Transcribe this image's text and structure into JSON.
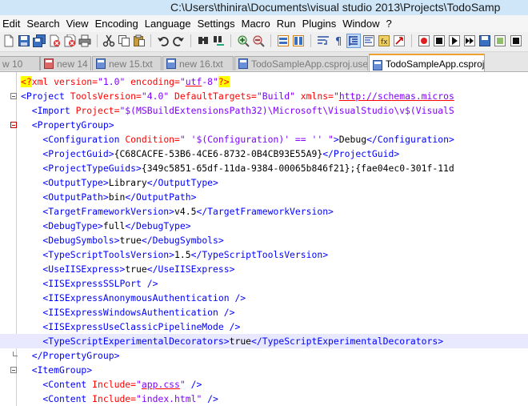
{
  "window": {
    "title": "C:\\Users\\thinira\\Documents\\visual studio 2013\\Projects\\TodoSamp"
  },
  "menubar": {
    "items": [
      "Edit",
      "Search",
      "View",
      "Encoding",
      "Language",
      "Settings",
      "Macro",
      "Run",
      "Plugins",
      "Window",
      "?"
    ]
  },
  "toolbar": {
    "icons": [
      "new-file-icon",
      "save-icon",
      "save-all-icon",
      "close-icon",
      "close-all-icon",
      "print-icon",
      "cut-icon",
      "copy-icon",
      "paste-icon",
      "undo-icon",
      "redo-icon",
      "find-icon",
      "replace-icon",
      "zoom-in-icon",
      "zoom-out-icon",
      "sync-v-icon",
      "sync-h-icon",
      "word-wrap-icon",
      "show-all-chars-icon",
      "indent-guide-icon",
      "doc-map-icon",
      "function-list-icon",
      "record-icon",
      "stop-icon",
      "play-icon",
      "play-multiple-icon",
      "save-macro-icon"
    ]
  },
  "tabs": [
    {
      "label": "w 10"
    },
    {
      "label": "new 14"
    },
    {
      "label": "new 15.txt"
    },
    {
      "label": "new 16.txt"
    },
    {
      "label": "TodoSampleApp.csproj.user"
    },
    {
      "label": "TodoSampleApp.csproj"
    }
  ],
  "editor": {
    "lines": [
      {
        "segments": [
          {
            "t": "<?",
            "c": "decl"
          },
          {
            "t": "xml version=",
            "c": "attr"
          },
          {
            "t": "\"1.0\"",
            "c": "val"
          },
          {
            "t": " encoding=",
            "c": "attr"
          },
          {
            "t": "\"",
            "c": "val"
          },
          {
            "t": "utf",
            "c": "val",
            "u": true
          },
          {
            "t": "-8\"",
            "c": "val"
          },
          {
            "t": "?>",
            "c": "decl"
          }
        ]
      },
      {
        "segments": [
          {
            "t": "<Project ",
            "c": "tag"
          },
          {
            "t": "ToolsVersion=",
            "c": "attr"
          },
          {
            "t": "\"4.0\"",
            "c": "val"
          },
          {
            "t": " DefaultTargets=",
            "c": "attr"
          },
          {
            "t": "\"Build\"",
            "c": "val"
          },
          {
            "t": " xmlns=",
            "c": "attr"
          },
          {
            "t": "\"",
            "c": "val"
          },
          {
            "t": "http://schemas.micros",
            "c": "val",
            "u": true
          }
        ]
      },
      {
        "segments": [
          {
            "t": "  <Import ",
            "c": "tag"
          },
          {
            "t": "Project=",
            "c": "attr"
          },
          {
            "t": "\"$(MSBuildExtensionsPath32)\\Microsoft\\VisualStudio\\v$(VisualS",
            "c": "val"
          }
        ]
      },
      {
        "segments": [
          {
            "t": "  <PropertyGroup>",
            "c": "tag"
          }
        ]
      },
      {
        "segments": [
          {
            "t": "    <Configuration ",
            "c": "tag"
          },
          {
            "t": "Condition=",
            "c": "attr"
          },
          {
            "t": "\" '$(Configuration)' == '' \"",
            "c": "val"
          },
          {
            "t": ">",
            "c": "tag"
          },
          {
            "t": "Debug",
            "c": "text"
          },
          {
            "t": "</Configuration>",
            "c": "tag"
          }
        ]
      },
      {
        "segments": [
          {
            "t": "    <ProjectGuid>",
            "c": "tag"
          },
          {
            "t": "{C68CACFE-53B6-4CE6-8732-0B4CB93E55A9}",
            "c": "text"
          },
          {
            "t": "</ProjectGuid>",
            "c": "tag"
          }
        ]
      },
      {
        "segments": [
          {
            "t": "    <ProjectTypeGuids>",
            "c": "tag"
          },
          {
            "t": "{349c5851-65df-11da-9384-00065b846f21};{fae04ec0-301f-11d",
            "c": "text"
          }
        ]
      },
      {
        "segments": [
          {
            "t": "    <OutputType>",
            "c": "tag"
          },
          {
            "t": "Library",
            "c": "text"
          },
          {
            "t": "</OutputType>",
            "c": "tag"
          }
        ]
      },
      {
        "segments": [
          {
            "t": "    <OutputPath>",
            "c": "tag"
          },
          {
            "t": "bin",
            "c": "text"
          },
          {
            "t": "</OutputPath>",
            "c": "tag"
          }
        ]
      },
      {
        "segments": [
          {
            "t": "    <TargetFrameworkVersion>",
            "c": "tag"
          },
          {
            "t": "v4.5",
            "c": "text"
          },
          {
            "t": "</TargetFrameworkVersion>",
            "c": "tag"
          }
        ]
      },
      {
        "segments": [
          {
            "t": "    <DebugType>",
            "c": "tag"
          },
          {
            "t": "full",
            "c": "text"
          },
          {
            "t": "</DebugType>",
            "c": "tag"
          }
        ]
      },
      {
        "segments": [
          {
            "t": "    <DebugSymbols>",
            "c": "tag"
          },
          {
            "t": "true",
            "c": "text"
          },
          {
            "t": "</DebugSymbols>",
            "c": "tag"
          }
        ]
      },
      {
        "segments": [
          {
            "t": "    <TypeScriptToolsVersion>",
            "c": "tag"
          },
          {
            "t": "1.5",
            "c": "text"
          },
          {
            "t": "</TypeScriptToolsVersion>",
            "c": "tag"
          }
        ]
      },
      {
        "segments": [
          {
            "t": "    <UseIISExpress>",
            "c": "tag"
          },
          {
            "t": "true",
            "c": "text"
          },
          {
            "t": "</UseIISExpress>",
            "c": "tag"
          }
        ]
      },
      {
        "segments": [
          {
            "t": "    <IISExpressSSLPort />",
            "c": "tag"
          }
        ]
      },
      {
        "segments": [
          {
            "t": "    <IISExpressAnonymousAuthentication />",
            "c": "tag"
          }
        ]
      },
      {
        "segments": [
          {
            "t": "    <IISExpressWindowsAuthentication />",
            "c": "tag"
          }
        ]
      },
      {
        "segments": [
          {
            "t": "    <IISExpressUseClassicPipelineMode />",
            "c": "tag"
          }
        ]
      },
      {
        "segments": [
          {
            "t": "    <TypeScriptExperimentalDecorators>",
            "c": "tag"
          },
          {
            "t": "true",
            "c": "text"
          },
          {
            "t": "</TypeScriptExperimentalDecorators>",
            "c": "tag"
          }
        ]
      },
      {
        "segments": [
          {
            "t": "  </PropertyGroup>",
            "c": "tag"
          }
        ]
      },
      {
        "segments": [
          {
            "t": "  <ItemGroup>",
            "c": "tag"
          }
        ]
      },
      {
        "segments": [
          {
            "t": "    <Content ",
            "c": "tag"
          },
          {
            "t": "Include=",
            "c": "attr"
          },
          {
            "t": "\"",
            "c": "val"
          },
          {
            "t": "app.css",
            "c": "val",
            "u": true
          },
          {
            "t": "\"",
            "c": "val"
          },
          {
            "t": " />",
            "c": "tag"
          }
        ]
      },
      {
        "segments": [
          {
            "t": "    <Content ",
            "c": "tag"
          },
          {
            "t": "Include=",
            "c": "attr"
          },
          {
            "t": "\"index.html\"",
            "c": "val"
          },
          {
            "t": " />",
            "c": "tag"
          }
        ]
      }
    ]
  }
}
